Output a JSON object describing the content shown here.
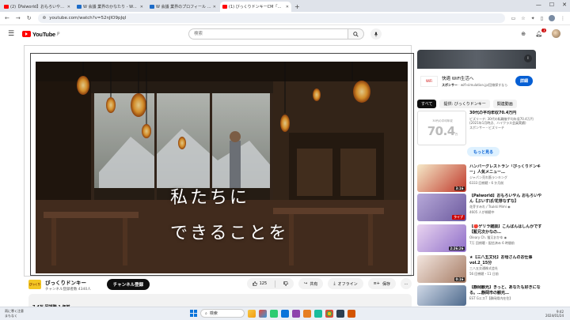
{
  "browser": {
    "tabs": [
      {
        "label": "(2)【Palworld】おもろいやん(2)",
        "icon_color": "#ff0000",
        "active": false
      },
      {
        "label": "W 会議 業界のかなたり - Wantedly",
        "icon_color": "#1d6cc8",
        "active": false
      },
      {
        "label": "W 会議 業界のプロフィール - Wantedly",
        "icon_color": "#1d6cc8",
        "active": false
      },
      {
        "label": "(1) びっくりドンキーCM「豊らし",
        "icon_color": "#ff0000",
        "active": true
      }
    ],
    "new_tab_label": "+",
    "address": "youtube.com/watch?v=52nJlO9pJqI",
    "window_controls": [
      "—",
      "☐",
      "✕"
    ]
  },
  "youtube": {
    "logo_text": "YouTube",
    "logo_region": "JP",
    "search_placeholder": "検索",
    "notification_count": "3"
  },
  "video": {
    "caption_line1": "私たちに",
    "caption_line2": "できることを"
  },
  "channel": {
    "avatar_text": "びっくり",
    "name": "びっくりドンキー",
    "subscribers": "チャンネル登録者数 4340人",
    "subscribe_label": "チャンネル登録"
  },
  "actions": {
    "like_count": "125",
    "share_label": "共有",
    "offline_label": "オフライン",
    "save_label": "保存",
    "more_label": "…"
  },
  "description": {
    "stats": "7.4万 回視聴  1 年前"
  },
  "sidebar": {
    "ad": {
      "logo_text": "WiFi",
      "title": "快適 WiFi生活へ",
      "sponsor_label": "スポンサー",
      "sponsor_url": "wifi-simulation.jp/回線探すなら",
      "button_label": "詳細"
    },
    "chips": [
      {
        "label": "すべて",
        "active": true
      },
      {
        "label": "提供: びっくりドンキー",
        "active": false
      },
      {
        "label": "関連動画",
        "active": false
      }
    ],
    "rich_ad": {
      "price_small": "30代の平均年収",
      "price_big": "70.4",
      "price_unit": "万",
      "title": "30代の平均年収70.4万円",
      "body": "ビズリーチ: 30代の転職後平均年収70.4万円 (2021年1月時点、ハイクラス会員実績)",
      "sponsor": "スポンサー・ビズリーチ",
      "more_label": "もっと見る"
    },
    "items": [
      {
        "title": "ハンバーグレストラン「びっくりドンキー」人気メニュー…",
        "channel": "ジャパン売れ筋ランキング",
        "stats": "6333 回視聴・6 か月前",
        "duration": "3:16",
        "thumb": [
          "#f5e9c8",
          "#c0392b"
        ]
      },
      {
        "title": "【Palworld】おもろいやん おもろいやん【ぶいすぽ/花芽なずな】",
        "channel": "花芽すみれ / Tsukki Mimi ◉",
        "stats": "4605 人が視聴中",
        "duration": "ライブ",
        "live": true,
        "thumb": [
          "#b7a9d9",
          "#6c5a9e"
        ]
      },
      {
        "title": "【🔴ゲリラ雑談】こんばんはしんかです【藍兄次かなの…",
        "channel": "Oleary Ch. 猫又おかゆ ◉",
        "stats": "7万 回視聴・配信済み 6 時間前",
        "duration": "2:26:26",
        "thumb": [
          "#e9d4f0",
          "#8e6ec8"
        ]
      },
      {
        "title": "★【三八五文化】お母さんのお仕事vol.2_15分",
        "channel": "三八五交通株式会社",
        "stats": "56 回視聴・11 日前",
        "duration": "0:16",
        "thumb": [
          "#f3e6df",
          "#a67c65"
        ]
      },
      {
        "title": "【静岡観光】きっと、あなたも好きになる。…静岡市の観光…",
        "channel": "EST GエスT【静岡県内在住】",
        "stats": "",
        "duration": "",
        "thumb": [
          "#cfd8e6",
          "#4e6a8d"
        ]
      }
    ]
  },
  "taskbar": {
    "weather_line1": "雨に寒く注意",
    "weather_line2": "まもなく",
    "search_label": "検索",
    "time": "9:42",
    "date": "2024/01/24"
  },
  "colors": {
    "accent_red": "#ff0000",
    "link_blue": "#065fd4",
    "subscribe_black": "#0f0f0f"
  }
}
